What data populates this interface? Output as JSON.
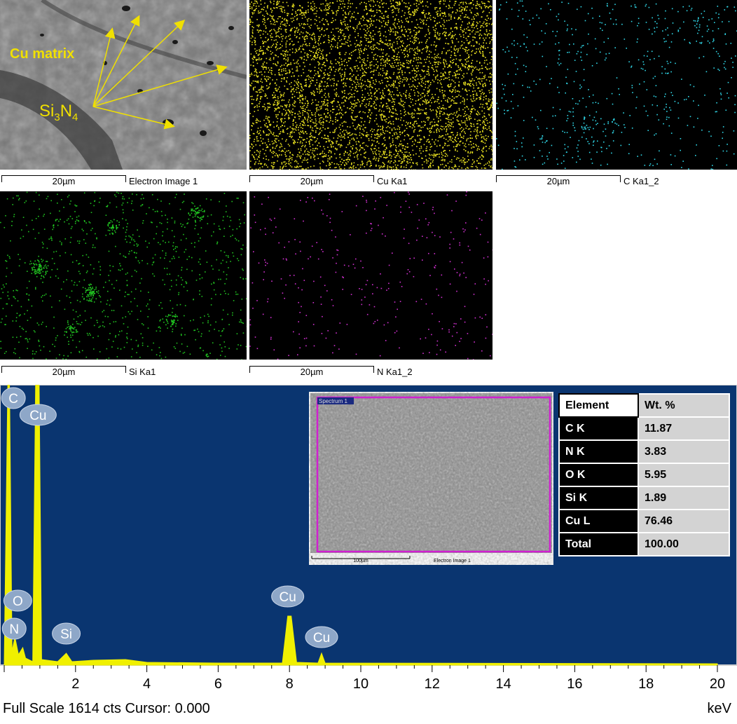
{
  "panels": {
    "electron": {
      "label": "Electron Image 1",
      "scale": "20µm",
      "annotation_matrix": "Cu matrix",
      "annotation_particle_main": "Si",
      "annotation_particle_sub1": "3",
      "annotation_particle_mid": "N",
      "annotation_particle_sub2": "4"
    },
    "cu": {
      "label": "Cu Ka1",
      "scale": "20µm",
      "color": "#e8e020"
    },
    "c": {
      "label": "C Ka1_2",
      "scale": "20µm",
      "color": "#30d8e8"
    },
    "si": {
      "label": "Si Ka1",
      "scale": "20µm",
      "color": "#20c020"
    },
    "n": {
      "label": "N Ka1_2",
      "scale": "20µm",
      "color": "#d030d0"
    }
  },
  "spectrum": {
    "background": "#0a3570",
    "trace_color": "#f0f000",
    "x_ticks": [
      "2",
      "4",
      "6",
      "8",
      "10",
      "12",
      "14",
      "16",
      "18",
      "20"
    ],
    "x_unit": "keV",
    "footer": "Full Scale 1614 cts Cursor: 0.000",
    "peak_labels": [
      "C",
      "Cu",
      "O",
      "N",
      "Si",
      "Cu",
      "Cu"
    ],
    "inset": {
      "tag": "Spectrum 1",
      "scale": "100µm",
      "label": "Electron Image 1"
    }
  },
  "table": {
    "header": {
      "element": "Element",
      "wt": "Wt. %"
    },
    "rows": [
      {
        "element": "C K",
        "wt": "11.87"
      },
      {
        "element": "N K",
        "wt": "3.83"
      },
      {
        "element": "O K",
        "wt": "5.95"
      },
      {
        "element": "Si K",
        "wt": "1.89"
      },
      {
        "element": "Cu L",
        "wt": "76.46"
      },
      {
        "element": "Total",
        "wt": "100.00"
      }
    ]
  }
}
